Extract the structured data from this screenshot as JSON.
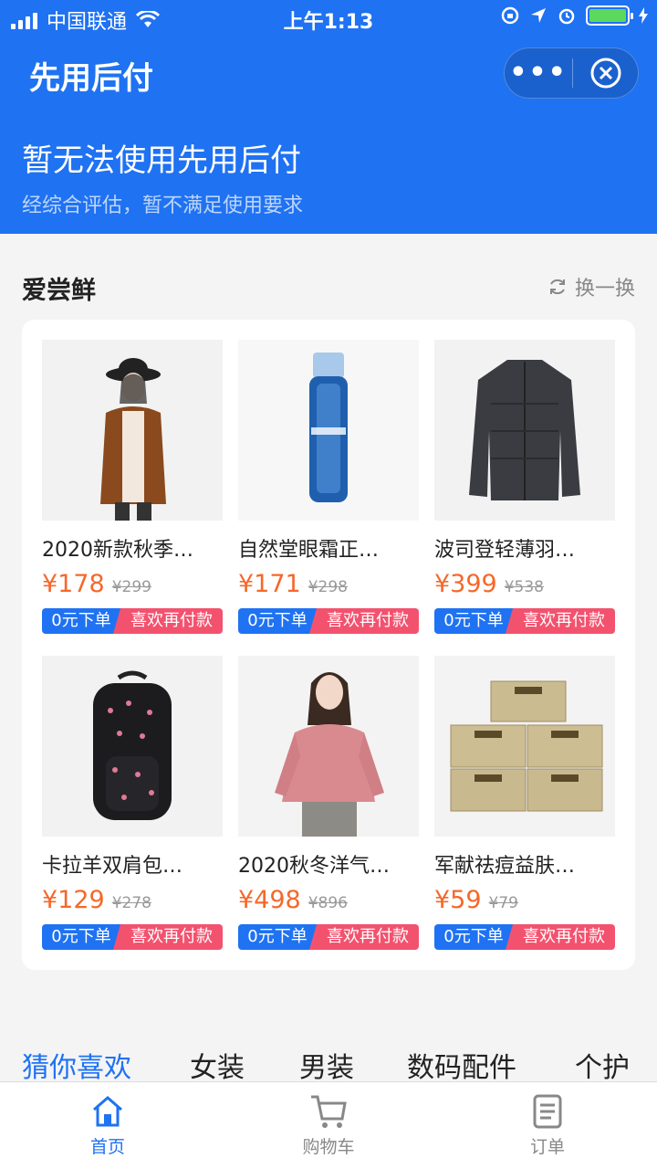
{
  "status": {
    "carrier": "中国联通",
    "time": "上午1:13"
  },
  "header": {
    "title": "先用后付",
    "more_label": "•••"
  },
  "notice": {
    "title": "暂无法使用先用后付",
    "subtitle": "经综合评估，暂不满足使用要求"
  },
  "section": {
    "title": "爱尝鲜",
    "refresh_label": "换一换"
  },
  "products": [
    {
      "name": "2020新款秋季…",
      "price": "¥178",
      "orig": "¥299",
      "tag1": "0元下单",
      "tag2": "喜欢再付款"
    },
    {
      "name": "自然堂眼霜正…",
      "price": "¥171",
      "orig": "¥298",
      "tag1": "0元下单",
      "tag2": "喜欢再付款"
    },
    {
      "name": "波司登轻薄羽…",
      "price": "¥399",
      "orig": "¥538",
      "tag1": "0元下单",
      "tag2": "喜欢再付款"
    },
    {
      "name": "卡拉羊双肩包…",
      "price": "¥129",
      "orig": "¥278",
      "tag1": "0元下单",
      "tag2": "喜欢再付款"
    },
    {
      "name": "2020秋冬洋气…",
      "price": "¥498",
      "orig": "¥896",
      "tag1": "0元下单",
      "tag2": "喜欢再付款"
    },
    {
      "name": "军献祛痘益肤…",
      "price": "¥59",
      "orig": "¥79",
      "tag1": "0元下单",
      "tag2": "喜欢再付款"
    }
  ],
  "categories": [
    "猜你喜欢",
    "女装",
    "男装",
    "数码配件",
    "个护"
  ],
  "tabbar": {
    "home": "首页",
    "cart": "购物车",
    "orders": "订单"
  },
  "colors": {
    "brand": "#1f72f2",
    "price": "#f5682a",
    "tag_pink": "#f3526e"
  }
}
